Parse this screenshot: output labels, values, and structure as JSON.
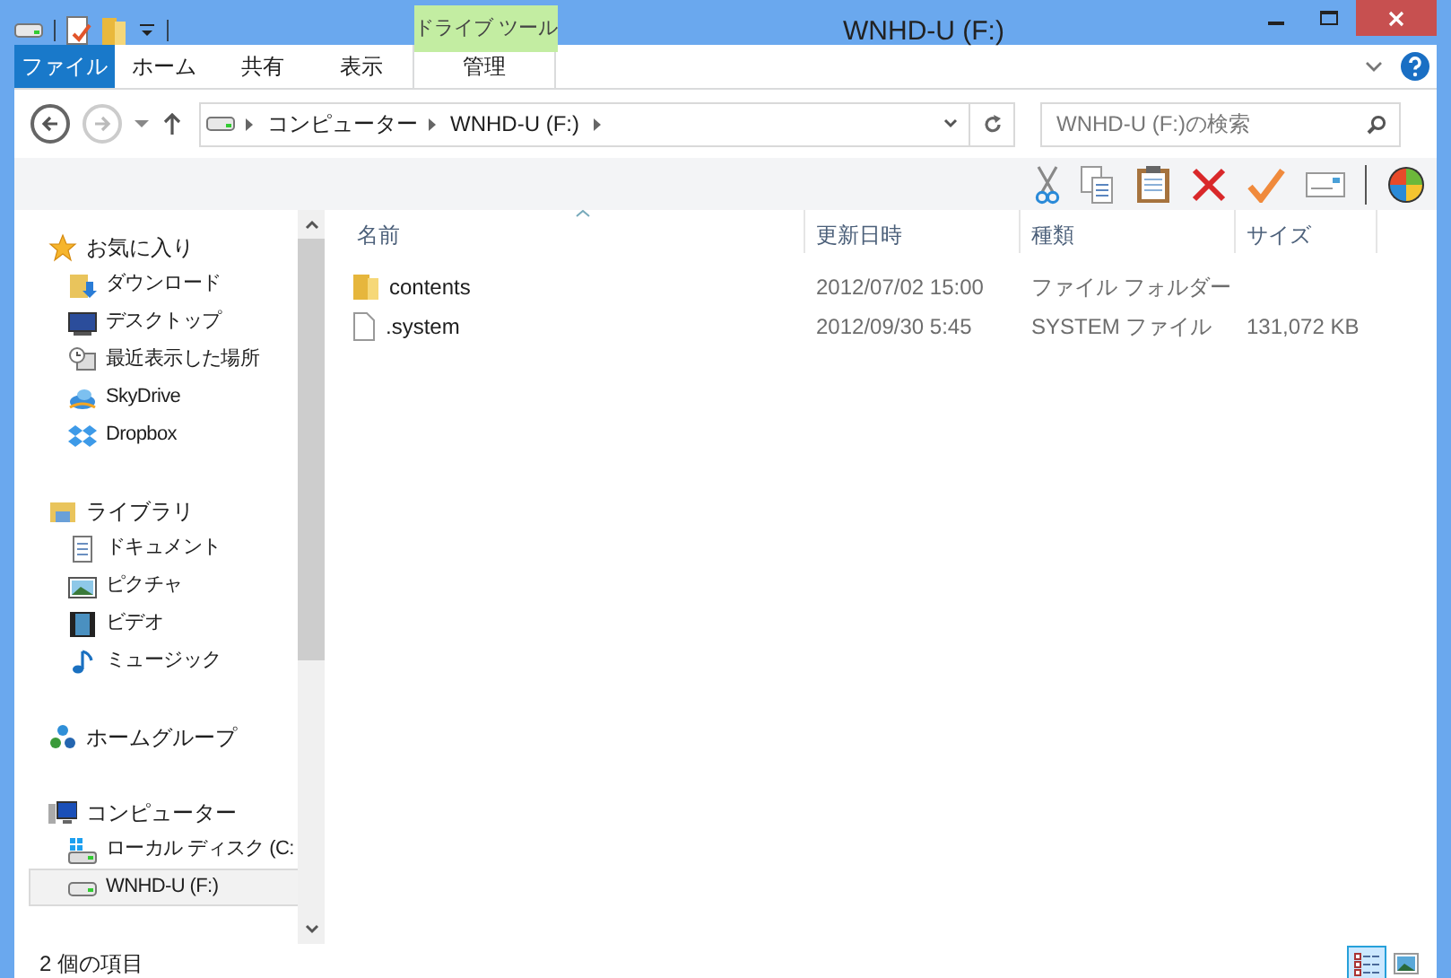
{
  "window": {
    "title": "WNHD-U (F:)"
  },
  "ribbon": {
    "contextual_label": "ドライブ ツール",
    "tabs": [
      {
        "label": "ファイル",
        "kind": "file"
      },
      {
        "label": "ホーム",
        "kind": "normal"
      },
      {
        "label": "共有",
        "kind": "normal"
      },
      {
        "label": "表示",
        "kind": "normal"
      },
      {
        "label": "管理",
        "kind": "contextual"
      }
    ]
  },
  "address": {
    "path": [
      "コンピューター",
      "WNHD-U (F:)"
    ]
  },
  "search": {
    "placeholder": "WNHD-U (F:)の検索"
  },
  "sidebar": {
    "groups": [
      {
        "label": "お気に入り",
        "kind": "star",
        "children": [
          {
            "label": "ダウンロード",
            "kind": "download",
            "selected": false
          },
          {
            "label": "デスクトップ",
            "kind": "desktop",
            "selected": false
          },
          {
            "label": "最近表示した場所",
            "kind": "recent",
            "selected": false
          },
          {
            "label": "SkyDrive",
            "kind": "cloud",
            "selected": false
          },
          {
            "label": "Dropbox",
            "kind": "box",
            "selected": false
          }
        ]
      },
      {
        "label": "ライブラリ",
        "kind": "library",
        "children": [
          {
            "label": "ドキュメント",
            "kind": "doc",
            "selected": false
          },
          {
            "label": "ピクチャ",
            "kind": "picture",
            "selected": false
          },
          {
            "label": "ビデオ",
            "kind": "video",
            "selected": false
          },
          {
            "label": "ミュージック",
            "kind": "music",
            "selected": false
          }
        ]
      },
      {
        "label": "ホームグループ",
        "kind": "homegroup"
      },
      {
        "label": "コンピューター",
        "kind": "computer",
        "children": [
          {
            "label": "ローカル ディスク (C:",
            "kind": "localdisk",
            "selected": false
          },
          {
            "label": "WNHD-U (F:)",
            "kind": "drive",
            "selected": true
          }
        ]
      }
    ]
  },
  "table": {
    "columns": [
      {
        "label": "名前",
        "sorted": true
      },
      {
        "label": "更新日時",
        "sorted": false
      },
      {
        "label": "種類",
        "sorted": false
      },
      {
        "label": "サイズ",
        "sorted": false
      }
    ],
    "rows": [
      {
        "kind": "folder",
        "name": "contents",
        "date": "2012/07/02 15:00",
        "type": "ファイル フォルダー"
      },
      {
        "kind": "file",
        "name": ".system",
        "date": "2012/09/30 5:45",
        "type": "SYSTEM ファイル",
        "size": "131,072 KB"
      }
    ]
  },
  "status_bar": {
    "text": "2 個の項目",
    "views": [
      {
        "kind": "details",
        "selected": true
      },
      {
        "kind": "thumbnails",
        "selected": false
      }
    ]
  }
}
